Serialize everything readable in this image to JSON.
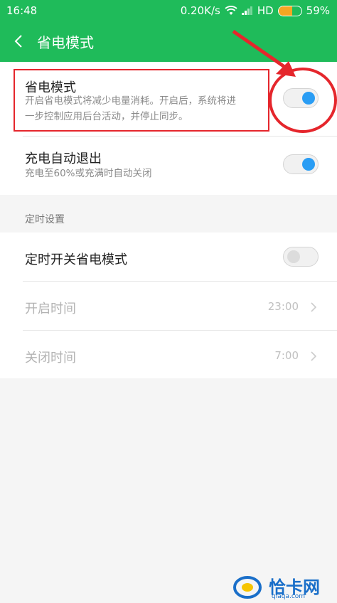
{
  "status_bar": {
    "time": "16:48",
    "speed": "0.20K/s",
    "network": "HD",
    "battery_percent": "59%",
    "battery_level": 0.59,
    "battery_color": "#f6a623"
  },
  "header": {
    "title": "省电模式",
    "accent_color": "#1fbb5a"
  },
  "settings": {
    "power_saving": {
      "title": "省电模式",
      "subtitle_line1": "开启省电模式将减少电量消耗。开启后，系统将进",
      "subtitle_line2": "一步控制应用后台活动，并停止同步。",
      "enabled": true
    },
    "auto_exit": {
      "title": "充电自动退出",
      "subtitle": "充电至60%或充满时自动关闭",
      "enabled": true
    }
  },
  "schedule": {
    "section_label": "定时设置",
    "toggle": {
      "title": "定时开关省电模式",
      "enabled": false
    },
    "start": {
      "title": "开启时间",
      "value": "23:00"
    },
    "end": {
      "title": "关闭时间",
      "value": "7:00"
    }
  },
  "watermark": {
    "logo_text": "恰卡网",
    "url": "qiaqa.com"
  },
  "colors": {
    "switch_on": "#2a9df4",
    "annotation": "#e5262c"
  },
  "icons": [
    "back-icon",
    "wifi-icon",
    "signal-icon",
    "battery-icon",
    "chevron-right-icon",
    "arrow-annotation"
  ]
}
